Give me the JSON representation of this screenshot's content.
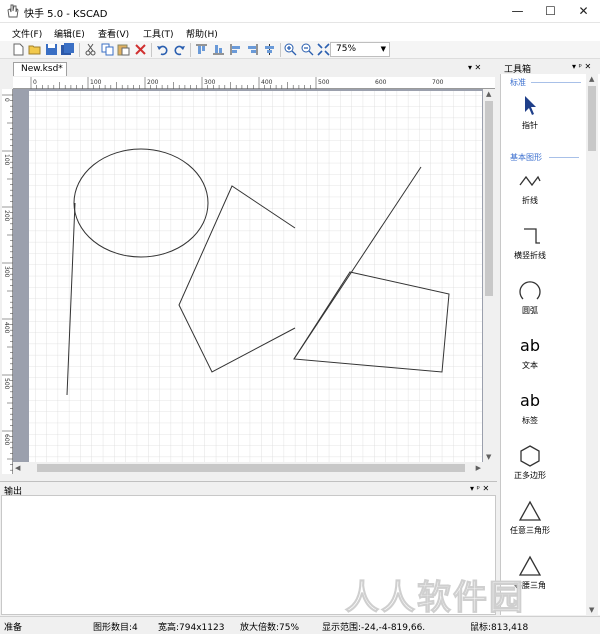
{
  "window": {
    "title": "快手 5.0 - KSCAD",
    "minimize": "—",
    "maximize": "☐",
    "close": "✕"
  },
  "menu": [
    "文件(F)",
    "编辑(E)",
    "查看(V)",
    "工具(T)",
    "帮助(H)"
  ],
  "toolbar": {
    "icons": [
      "new-icon",
      "open-icon",
      "save-icon",
      "save-all-icon",
      "cut-icon",
      "copy-icon",
      "paste-icon",
      "delete-icon",
      "undo-icon",
      "redo-icon",
      "align-top-icon",
      "align-bottom-icon",
      "align-left-icon",
      "align-right-icon",
      "zoom-in-icon",
      "zoom-out-icon",
      "fit-icon"
    ],
    "zoom_value": "75%"
  },
  "document": {
    "tab_label": "New.ksd*",
    "tab_controls": "▾ ✕",
    "hruler_labels": [
      "0",
      "100",
      "200",
      "300",
      "400",
      "500",
      "600",
      "700"
    ],
    "vruler_labels": [
      "0",
      "100",
      "200",
      "300",
      "400",
      "500",
      "600"
    ]
  },
  "output": {
    "title": "输出",
    "controls": "▾ ᵖ ✕"
  },
  "toolbox": {
    "title": "工具箱",
    "controls": "▾ ᵖ ✕",
    "sections": [
      "标准",
      "基本图形"
    ],
    "tools": [
      {
        "label": "指针",
        "icon": "pointer-icon"
      },
      {
        "label": "折线",
        "icon": "polyline-icon"
      },
      {
        "label": "横竖折线",
        "icon": "orthogonal-polyline-icon"
      },
      {
        "label": "圆弧",
        "icon": "arc-icon"
      },
      {
        "label": "文本",
        "icon": "text-icon",
        "glyph": "ab"
      },
      {
        "label": "标签",
        "icon": "label-icon",
        "glyph": "ab"
      },
      {
        "label": "正多边形",
        "icon": "hexagon-icon"
      },
      {
        "label": "任意三角形",
        "icon": "triangle-icon"
      },
      {
        "label": "等腰三角",
        "icon": "isosceles-triangle-icon"
      }
    ]
  },
  "status": {
    "ready": "准备",
    "shape_count": "图形数目:4",
    "page_size": "宽高:794x1123",
    "zoom": "放大倍数:75%",
    "display_range": "显示范围:-24,-4-819,66.",
    "mouse": "鼠标:813,418"
  },
  "watermark": "人人软件园",
  "colors": {
    "accent": "#3b6fcf",
    "canvas_bg": "#9ba0ad",
    "grid": "#d8d8d8"
  }
}
